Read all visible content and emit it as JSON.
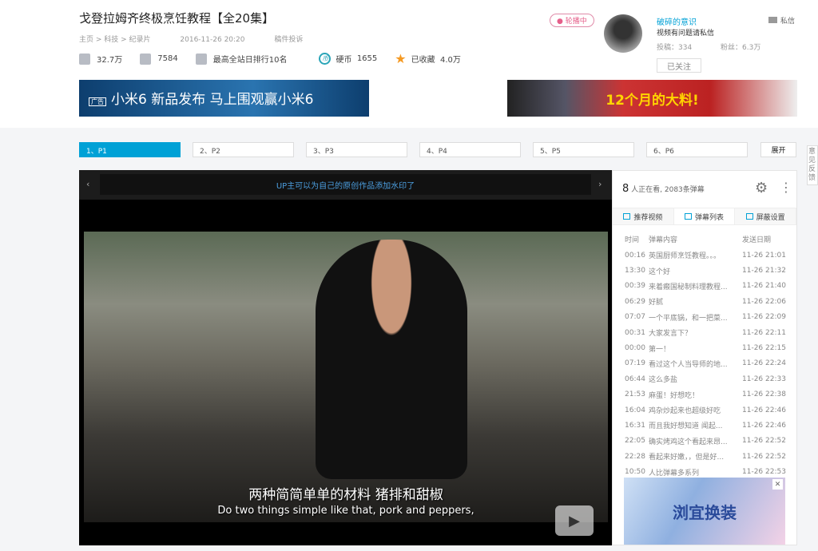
{
  "video": {
    "title": "戈登拉姆齐终极烹饪教程【全20集】",
    "breadcrumb": "主页 > 科技 > 纪录片",
    "date": "2016-11-26 20:20",
    "report": "稿件投诉",
    "stats": {
      "plays": "32.7万",
      "danmaku": "7584",
      "rank": "最高全站日排行10名",
      "coins_label": "硬币",
      "coins": "1655",
      "fav_label": "已收藏",
      "favs": "4.0万"
    }
  },
  "uploader": {
    "live_badge": "● 轮播中",
    "name": "破碎的意识",
    "signature": "视频有问题请私信",
    "posts": "投稿：334",
    "fans": "粉丝：6.3万",
    "follow_label": "已关注",
    "message_label": "私信"
  },
  "ads": {
    "left": "小米6 新品发布 马上围观赢小米6",
    "left_tag": "广告",
    "right": "12个月的大料!",
    "side": "浏宜换装",
    "ad_tag": "广告"
  },
  "parts": [
    {
      "label": "1、P1",
      "active": true
    },
    {
      "label": "2、P2"
    },
    {
      "label": "3、P3"
    },
    {
      "label": "4、P4"
    },
    {
      "label": "5、P5"
    },
    {
      "label": "6、P6"
    }
  ],
  "expand_label": "展开",
  "feedback_label": "意见反馈",
  "player": {
    "notice": "UP主可以为自己的原创作品添加水印了",
    "subtitle_cn": "两种简简单单的材料  猪排和甜椒",
    "subtitle_en": "Do two things simple like that, pork and peppers,"
  },
  "sidebar": {
    "watching_count": "8",
    "watching_text": " 人正在看, 2083条弹幕",
    "tabs": [
      "推荐视频",
      "弹幕列表",
      "屏蔽设置"
    ],
    "columns": [
      "时间",
      "弹幕内容",
      "发送日期"
    ],
    "rows": [
      [
        "00:16",
        "英国厨师烹饪教程。。。",
        "11-26 21:01"
      ],
      [
        "13:30",
        "这个好",
        "11-26 21:32"
      ],
      [
        "00:39",
        "来着瘢国秘制料理教程...",
        "11-26 21:40"
      ],
      [
        "06:29",
        "好腻",
        "11-26 22:06"
      ],
      [
        "07:07",
        "一个平底锅，和一把菜...",
        "11-26 22:09"
      ],
      [
        "00:31",
        "大家发言下？",
        "11-26 22:11"
      ],
      [
        "00:00",
        "第一！",
        "11-26 22:15"
      ],
      [
        "07:19",
        "看过这个人当导师的地...",
        "11-26 22:24"
      ],
      [
        "06:44",
        "这么多盐",
        "11-26 22:33"
      ],
      [
        "21:53",
        "麻蛋！好想吃！",
        "11-26 22:38"
      ],
      [
        "16:04",
        "鸡杂炒起来也超级好吃",
        "11-26 22:46"
      ],
      [
        "16:31",
        "而且我好想知道  闻起...",
        "11-26 22:46"
      ],
      [
        "22:05",
        "确实烤鸡这个看起来昂...",
        "11-26 22:52"
      ],
      [
        "22:28",
        "看起来好嫩，，但是好...",
        "11-26 22:52"
      ],
      [
        "10:50",
        "人比弹幕多系列",
        "11-26 22:53"
      ]
    ]
  },
  "colors": {
    "accent": "#00a1d6",
    "live": "#e55f8a",
    "coin": "#2aa5b8",
    "star": "#f59a23"
  }
}
